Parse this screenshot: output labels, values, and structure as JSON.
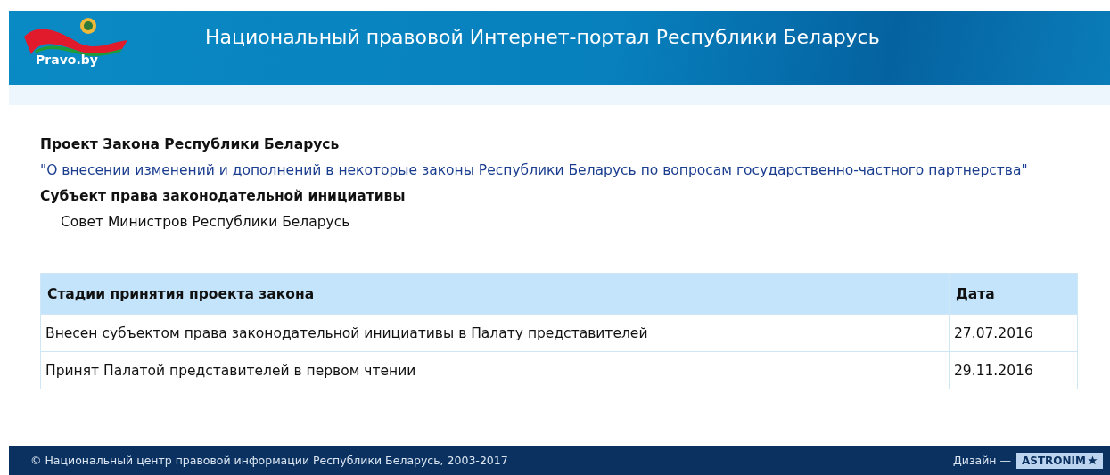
{
  "header": {
    "logo_text": "Pravo.by",
    "title": "Национальный правовой Интернет-портал Республики Беларусь"
  },
  "bill": {
    "heading": "Проект Закона Республики Беларусь",
    "link": "\"О внесении изменений и дополнений в некоторые законы Республики Беларусь по вопросам государственно-частного партнерства\"",
    "subject_heading": "Субъект права законодательной инициативы",
    "subject": "Совет Министров Республики Беларусь"
  },
  "table": {
    "columns": [
      "Стадии принятия проекта закона",
      "Дата"
    ],
    "rows": [
      [
        "Внесен субъектом права законодательной инициативы в Палату представителей",
        "27.07.2016"
      ],
      [
        "Принят Палатой представителей в первом чтении",
        "29.11.2016"
      ]
    ]
  },
  "footer": {
    "copyright": "© Национальный центр правовой информации Республики Беларусь, 2003-2017",
    "design_label": "Дизайн —",
    "designer": "ASTRONIM"
  }
}
